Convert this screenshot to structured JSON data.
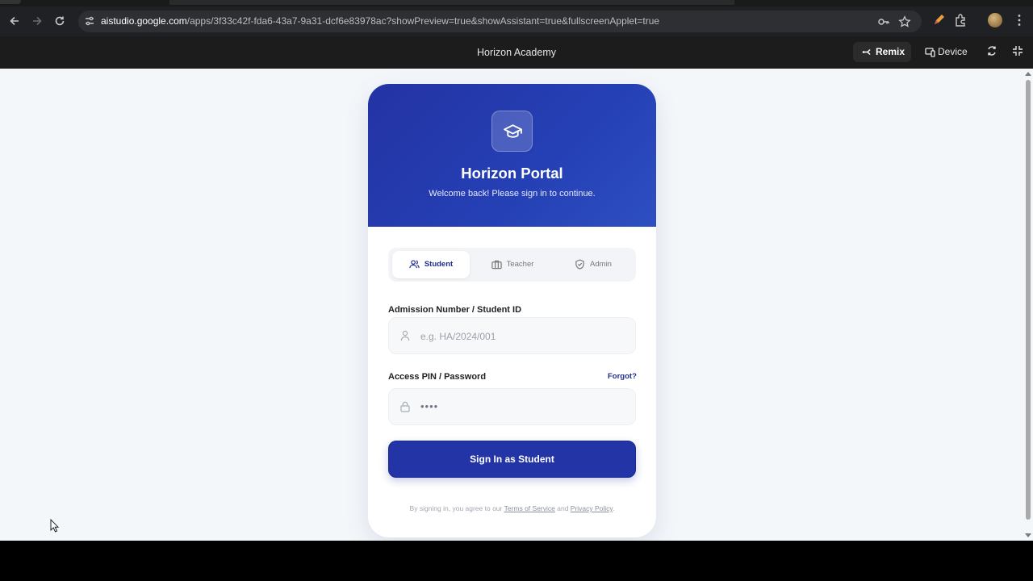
{
  "browser": {
    "url_host": "aistudio.google.com",
    "url_rest": "/apps/3f33c42f-fda6-43a7-9a31-dcf6e83978ac?showPreview=true&showAssistant=true&fullscreenApplet=true"
  },
  "appbar": {
    "title": "Horizon Academy",
    "remix_label": "Remix",
    "device_label": "Device"
  },
  "hero": {
    "title": "Horizon Portal",
    "subtitle": "Welcome back! Please sign in to continue."
  },
  "roles": [
    {
      "label": "Student",
      "icon": "users-icon",
      "active": true
    },
    {
      "label": "Teacher",
      "icon": "briefcase-icon",
      "active": false
    },
    {
      "label": "Admin",
      "icon": "shield-icon",
      "active": false
    }
  ],
  "form": {
    "id_label": "Admission Number / Student ID",
    "id_placeholder": "e.g. HA/2024/001",
    "pin_label": "Access PIN / Password",
    "forgot_label": "Forgot?",
    "pin_value": "••••",
    "submit_label": "Sign In as Student"
  },
  "terms": {
    "prefix": "By signing in, you agree to our ",
    "tos": "Terms of Service",
    "and": " and ",
    "privacy": "Privacy Policy",
    "suffix": "."
  },
  "colors": {
    "brand": "#2234a6",
    "page_bg": "#f4f7fa"
  }
}
